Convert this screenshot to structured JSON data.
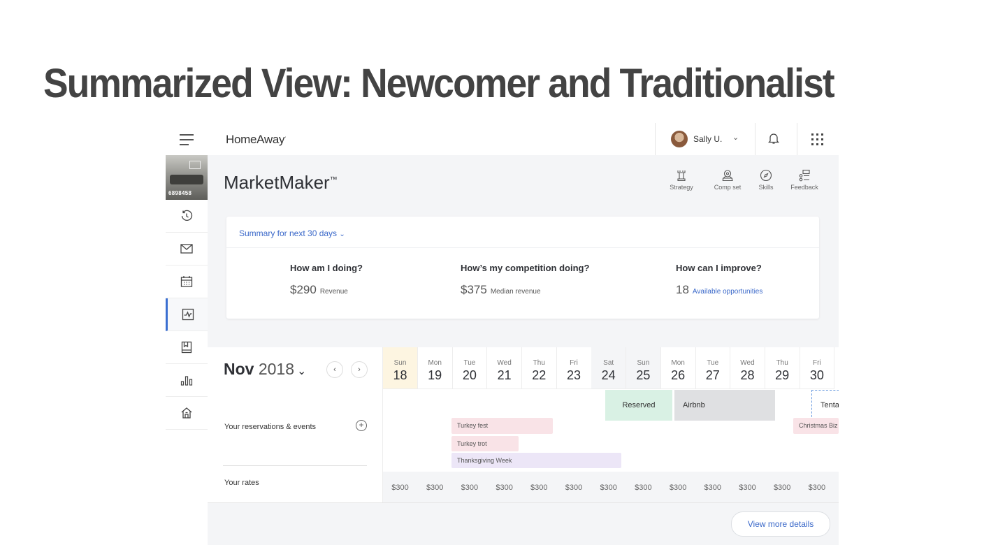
{
  "slide": {
    "title": "Summarized View: Newcomer and Traditionalist"
  },
  "topbar": {
    "brand": "HomeAway",
    "user_name": "Sally U."
  },
  "sidebar": {
    "listing_id": "6898458",
    "items": [
      {
        "icon": "history-icon"
      },
      {
        "icon": "mail-icon"
      },
      {
        "icon": "calendar-icon"
      },
      {
        "icon": "analytics-icon",
        "active": true
      },
      {
        "icon": "guidebook-icon"
      },
      {
        "icon": "bar-chart-icon"
      },
      {
        "icon": "home-icon"
      }
    ]
  },
  "header": {
    "product": "MarketMaker",
    "product_mark": "™",
    "tools": [
      "Strategy",
      "Comp set",
      "Skills",
      "Feedback"
    ]
  },
  "summary": {
    "toggle": "Summary for next 30 days",
    "metrics": [
      {
        "question": "How am I doing?",
        "value": "$290",
        "label": "Revenue"
      },
      {
        "question": "How’s my competition doing?",
        "value": "$375",
        "label": "Median revenue"
      },
      {
        "question": "How can I improve?",
        "value": "18",
        "label": "Available opportunities"
      }
    ]
  },
  "calendar": {
    "month": "Nov",
    "year": "2018",
    "days": [
      {
        "dow": "Sun",
        "dom": "18"
      },
      {
        "dow": "Mon",
        "dom": "19"
      },
      {
        "dow": "Tue",
        "dom": "20"
      },
      {
        "dow": "Wed",
        "dom": "21"
      },
      {
        "dow": "Thu",
        "dom": "22"
      },
      {
        "dow": "Fri",
        "dom": "23"
      },
      {
        "dow": "Sat",
        "dom": "24"
      },
      {
        "dow": "Sun",
        "dom": "25"
      },
      {
        "dow": "Mon",
        "dom": "26"
      },
      {
        "dow": "Tue",
        "dom": "27"
      },
      {
        "dow": "Wed",
        "dom": "28"
      },
      {
        "dow": "Thu",
        "dom": "29"
      },
      {
        "dow": "Fri",
        "dom": "30"
      }
    ],
    "reservations_label": "Your reservations & events",
    "rates_label": "Your rates",
    "bookings": {
      "reserved": "Reserved",
      "airbnb": "Airbnb",
      "tentative": "Tenta"
    },
    "events": [
      {
        "name": "Turkey fest",
        "color": "#f9e3e7"
      },
      {
        "name": "Turkey trot",
        "color": "#f9e3e7"
      },
      {
        "name": "Thanksgiving Week",
        "color": "#ece6f7"
      },
      {
        "name": "Christmas Biz",
        "color": "#f9e3e7"
      }
    ],
    "rates": [
      "$300",
      "$300",
      "$300",
      "$300",
      "$300",
      "$300",
      "$300",
      "$300",
      "$300",
      "$300",
      "$300",
      "$300",
      "$300"
    ],
    "view_more": "View more details"
  }
}
